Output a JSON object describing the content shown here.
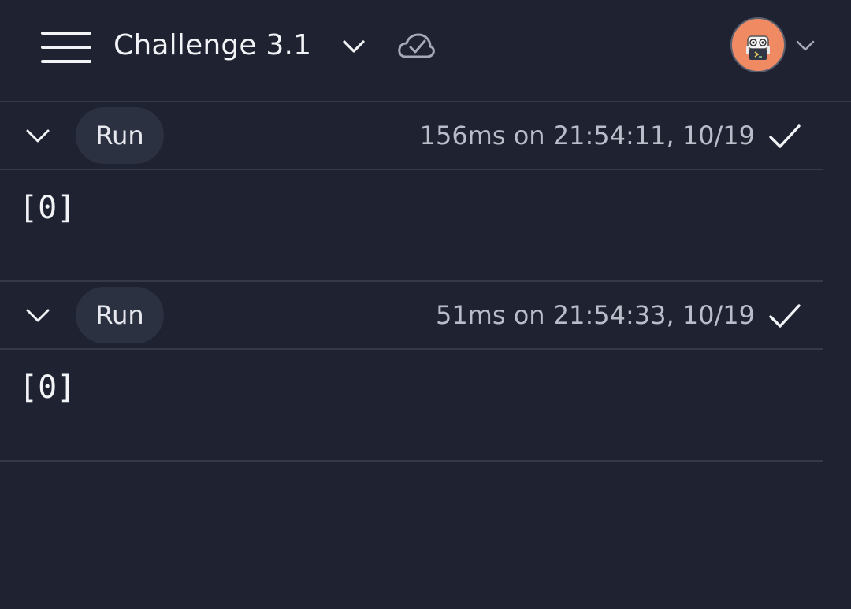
{
  "colors": {
    "background": "#1f2331",
    "pill": "#2c3142",
    "avatar_bg": "#f08a62",
    "divider": "#353a4a"
  },
  "header": {
    "title": "Challenge 3.1",
    "icons": [
      "menu-icon",
      "chevron-down-icon",
      "cloud-check-icon",
      "robot-avatar",
      "chevron-down-icon"
    ]
  },
  "runs": [
    {
      "button_label": "Run",
      "meta": "156ms on 21:54:11, 10/19",
      "status": "success",
      "output": "[0]"
    },
    {
      "button_label": "Run",
      "meta": "51ms on 21:54:33, 10/19",
      "status": "success",
      "output": "[0]"
    }
  ]
}
